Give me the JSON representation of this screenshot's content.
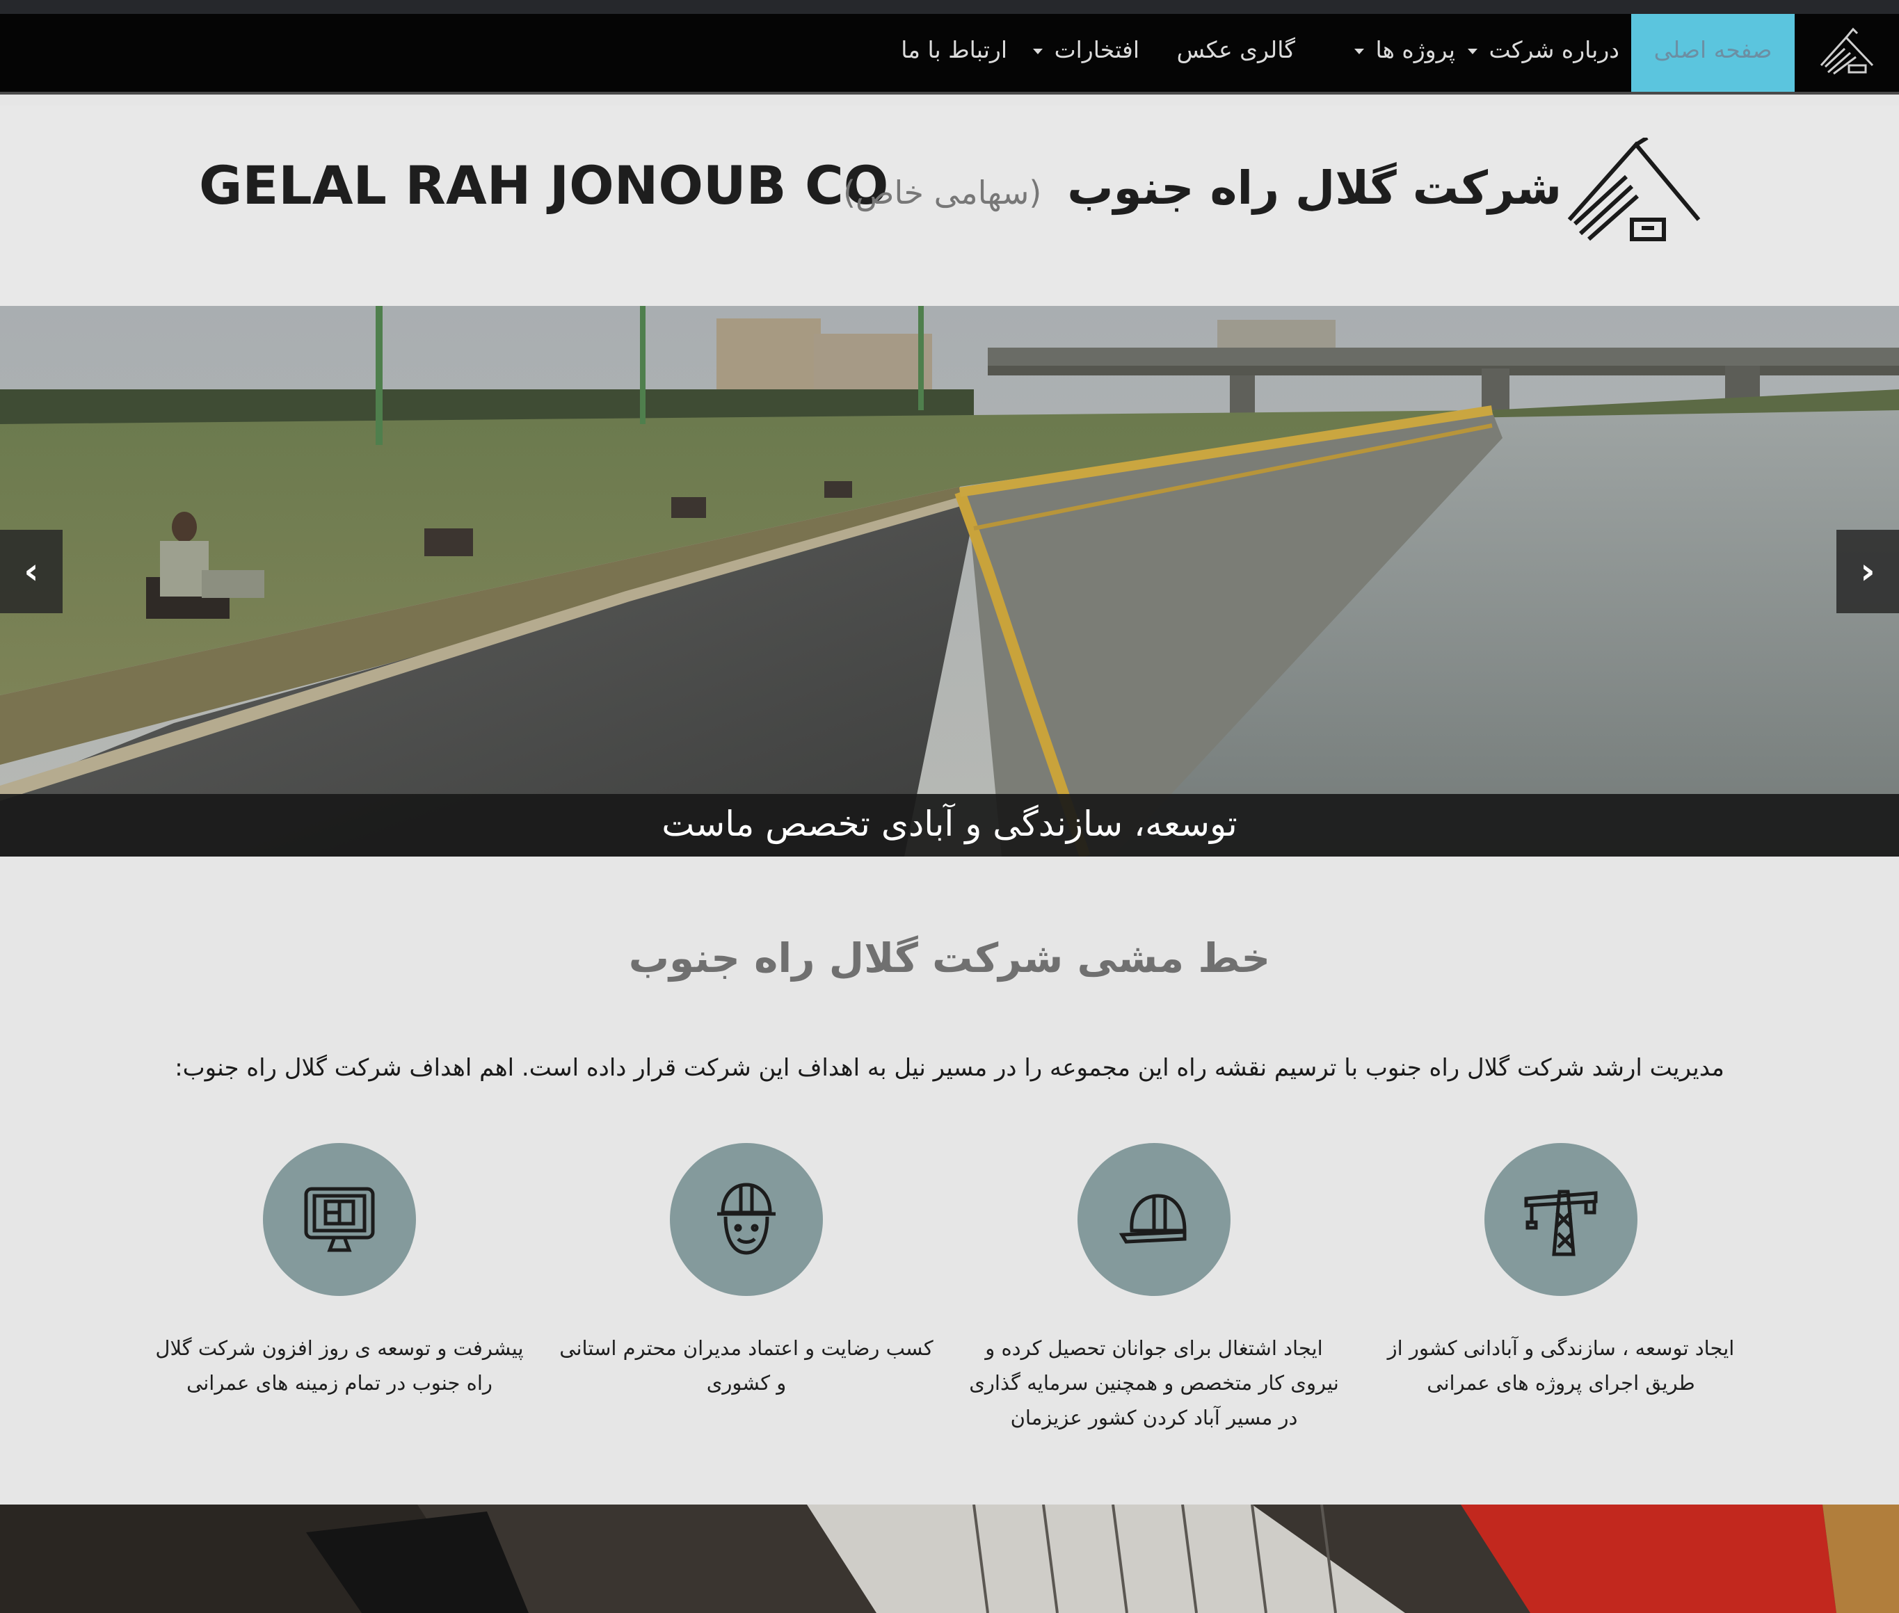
{
  "nav": {
    "items": [
      {
        "label": "صفحه اصلی",
        "active": true
      },
      {
        "label": "درباره شرکت",
        "dropdown": true
      },
      {
        "label": "پروژه ها",
        "dropdown": true
      },
      {
        "label": "گالری عکس",
        "dropdown": false
      },
      {
        "label": "افتخارات",
        "dropdown": true
      },
      {
        "label": "ارتباط با ما",
        "dropdown": false
      }
    ]
  },
  "header": {
    "brand_fa": "شرکت گلال راه جنوب",
    "brand_fa_sub": "(سهامی خاص)",
    "brand_en": "GELAL RAH JONOUB CO"
  },
  "slider": {
    "caption": "توسعه، سازندگی و آبادی تخصص ماست",
    "prev_label": "‹",
    "next_label": "›"
  },
  "mission": {
    "title": "خط مشی شرکت گلال راه جنوب",
    "text": "مدیریت ارشد شرکت گلال راه جنوب با ترسیم نقشه راه این مجموعه را در مسیر نیل به اهداف این شرکت قرار داده است. اهم اهداف شرکت گلال راه جنوب:",
    "goals": [
      {
        "icon": "crane-icon",
        "text": "ایجاد توسعه ، سازندگی و آبادانی کشور از طریق اجرای پروژه های عمرانی"
      },
      {
        "icon": "hardhat-icon",
        "text": "ایجاد اشتغال برای جوانان تحصیل کرده و نیروی کار متخصص و همچنین سرمایه گذاری در مسیر آباد کردن کشور عزیزمان"
      },
      {
        "icon": "worker-icon",
        "text": "کسب رضایت و اعتماد مدیران محترم استانی و کشوری"
      },
      {
        "icon": "blueprint-monitor-icon",
        "text": "پیشرفت و توسعه ی روز افزون شرکت گلال راه جنوب در تمام زمینه های عمرانی"
      }
    ]
  },
  "colors": {
    "nav_bg": "#050505",
    "nav_active": "#5bc5de",
    "goal_circle": "#849a9c",
    "page_bg": "#e6e6e6"
  }
}
